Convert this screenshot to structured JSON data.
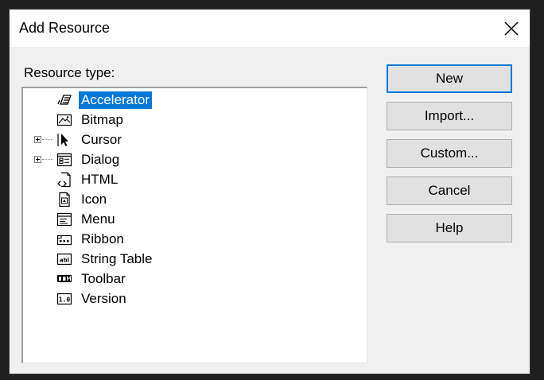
{
  "dialog": {
    "title": "Add Resource",
    "close_icon": "close-icon"
  },
  "resource_type_label": "Resource type:",
  "tree": {
    "items": [
      {
        "label": "Accelerator",
        "icon": "accelerator-icon",
        "expandable": false,
        "selected": true
      },
      {
        "label": "Bitmap",
        "icon": "bitmap-icon",
        "expandable": false,
        "selected": false
      },
      {
        "label": "Cursor",
        "icon": "cursor-icon",
        "expandable": true,
        "selected": false
      },
      {
        "label": "Dialog",
        "icon": "dialog-icon",
        "expandable": true,
        "selected": false
      },
      {
        "label": "HTML",
        "icon": "html-icon",
        "expandable": false,
        "selected": false
      },
      {
        "label": "Icon",
        "icon": "icon-resource-icon",
        "expandable": false,
        "selected": false
      },
      {
        "label": "Menu",
        "icon": "menu-icon",
        "expandable": false,
        "selected": false
      },
      {
        "label": "Ribbon",
        "icon": "ribbon-icon",
        "expandable": false,
        "selected": false
      },
      {
        "label": "String Table",
        "icon": "string-table-icon",
        "expandable": false,
        "selected": false
      },
      {
        "label": "Toolbar",
        "icon": "toolbar-icon",
        "expandable": false,
        "selected": false
      },
      {
        "label": "Version",
        "icon": "version-icon",
        "expandable": false,
        "selected": false
      }
    ]
  },
  "buttons": {
    "new": "New",
    "import": "Import...",
    "custom": "Custom...",
    "cancel": "Cancel",
    "help": "Help"
  },
  "colors": {
    "selection": "#0078d7",
    "default_button_border": "#0078d7"
  }
}
